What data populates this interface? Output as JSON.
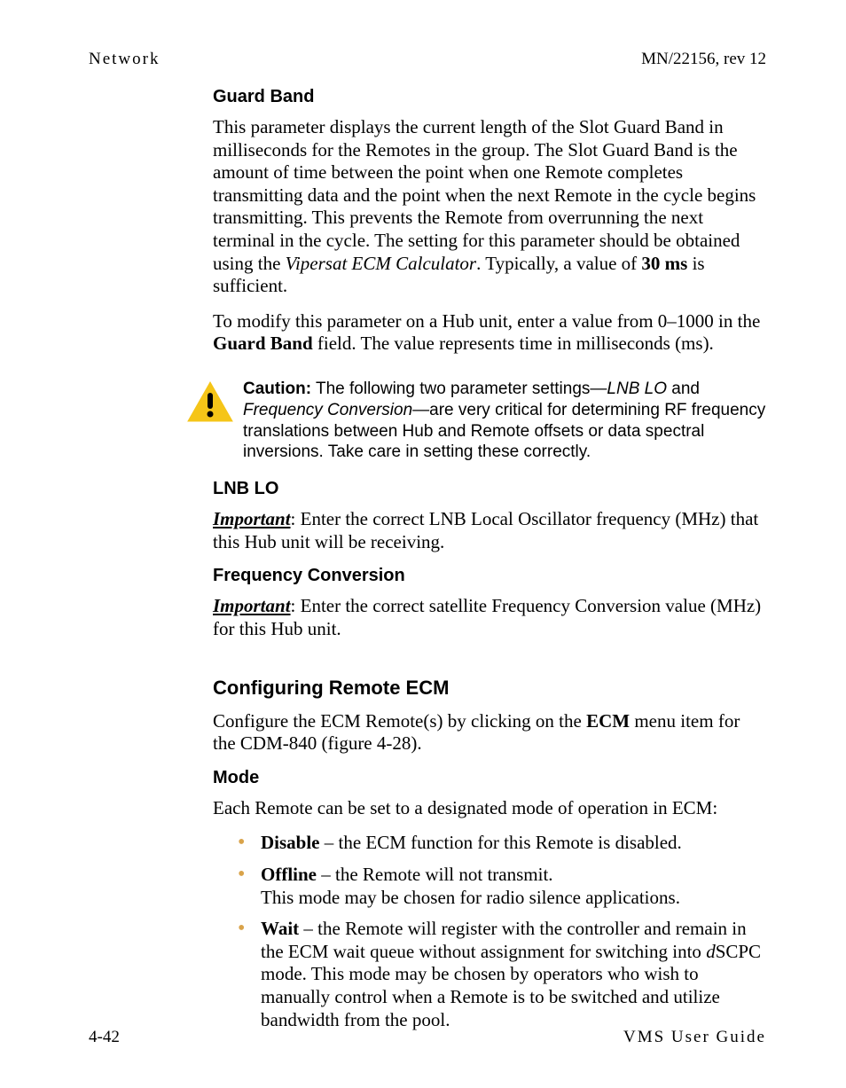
{
  "header": {
    "left": "Network",
    "right": "MN/22156, rev 12"
  },
  "sections": {
    "guard_band": {
      "title": "Guard Band",
      "p1_a": "This parameter displays the current length of the Slot Guard Band in milliseconds for the Remotes in the group. The Slot Guard Band is the amount of time between the point when one Remote completes transmitting data and the point when the next Remote in the cycle begins transmitting. This prevents the Remote from overrunning the next terminal in the cycle. The setting for this parameter should be obtained using the ",
      "p1_em": "Vipersat ECM Calculator",
      "p1_b": ". Typically, a value of ",
      "p1_bold": "30 ms",
      "p1_c": " is sufficient.",
      "p2_a": "To modify this parameter on a Hub unit, enter a value from 0–1000 in the ",
      "p2_bold": "Guard Band",
      "p2_b": " field. The value represents time in milliseconds (ms)."
    },
    "caution": {
      "label": "Caution:",
      "a": "The following two parameter settings—",
      "em1": "LNB LO",
      "mid": " and ",
      "em2": "Frequency Conversion",
      "b": "—are very critical for determining RF frequency translations between Hub and Remote offsets or data spectral inversions. Take care in setting these correctly."
    },
    "lnb_lo": {
      "title": "LNB LO",
      "lead": "Important",
      "rest": ": Enter the correct LNB Local Oscillator frequency (MHz) that this Hub unit will be receiving."
    },
    "freq_conv": {
      "title": "Frequency Conversion",
      "lead": "Important",
      "rest": ": Enter the correct satellite Frequency Conversion value (MHz) for this Hub unit."
    },
    "remote_ecm": {
      "title": "Configuring Remote ECM",
      "p_a": "Configure the ECM Remote(s) by clicking on the ",
      "p_bold": "ECM",
      "p_b": " menu item for the CDM-840 (figure 4-28)."
    },
    "mode": {
      "title": "Mode",
      "intro": "Each Remote can be set to a designated mode of operation in ECM:",
      "items": [
        {
          "name": "Disable",
          "rest": " – the ECM function for this Remote is disabled."
        },
        {
          "name": "Offline",
          "rest": " – the Remote will not transmit.",
          "line2": "This mode may be chosen for radio silence applications."
        },
        {
          "name": "Wait",
          "rest_a": " – the Remote will register with the controller and remain in the ECM wait queue without assignment for switching into ",
          "d": "d",
          "rest_b": "SCPC mode. This mode may be chosen by operators who wish to manually control when a Remote is to be switched and utilize bandwidth from the pool."
        }
      ]
    }
  },
  "footer": {
    "left": "4-42",
    "right": "VMS User Guide"
  }
}
